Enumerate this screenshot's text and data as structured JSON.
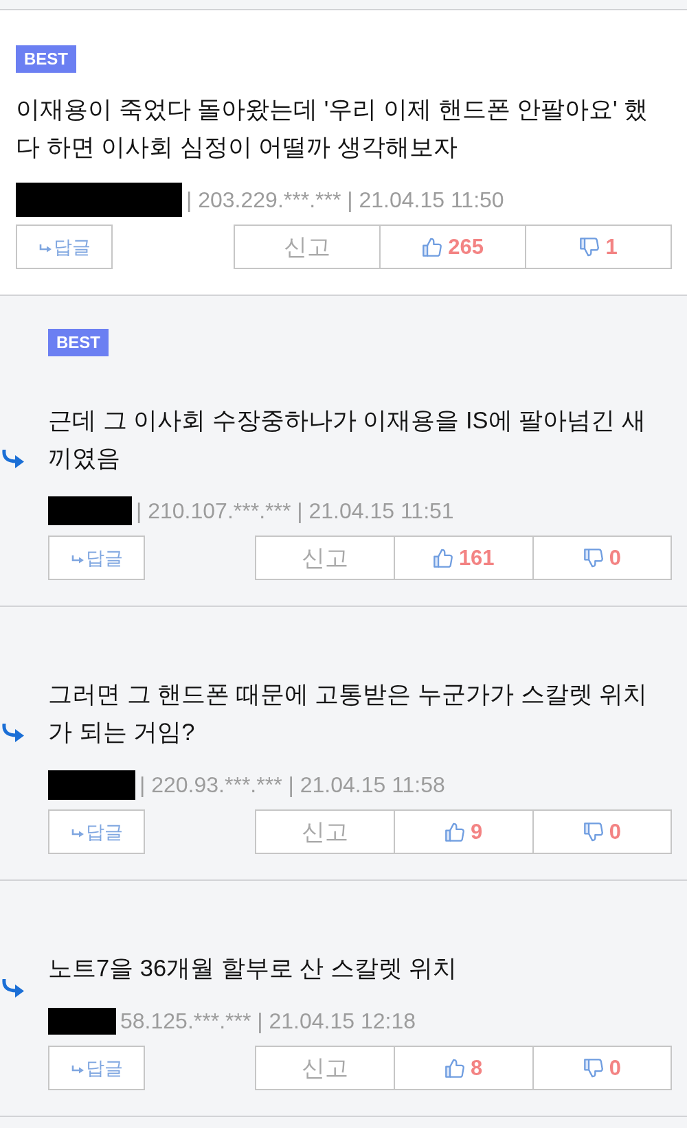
{
  "comments": [
    {
      "best": true,
      "best_label": "BEST",
      "reply": false,
      "text": "이재용이 죽었다 돌아왔는데 '우리 이제 핸드폰 안팔아요' 했다 하면 이사회 심정이 어떨까 생각해보자",
      "author_redacted": true,
      "meta": "| 203.229.***.*** | 21.04.15 11:50",
      "reply_label": "답글",
      "report_label": "신고",
      "likes": "265",
      "dislikes": "1"
    },
    {
      "best": true,
      "best_label": "BEST",
      "reply": true,
      "text": "근데 그 이사회 수장중하나가 이재용을 IS에 팔아넘긴 새끼였음",
      "author_redacted": true,
      "meta": "| 210.107.***.*** | 21.04.15 11:51",
      "reply_label": "답글",
      "report_label": "신고",
      "likes": "161",
      "dislikes": "0"
    },
    {
      "best": false,
      "reply": true,
      "text": "그러면 그 핸드폰 때문에 고통받은 누군가가 스칼렛 위치가 되는 거임?",
      "author_redacted": true,
      "meta": "| 220.93.***.*** | 21.04.15 11:58",
      "reply_label": "답글",
      "report_label": "신고",
      "likes": "9",
      "dislikes": "0"
    },
    {
      "best": false,
      "reply": true,
      "text": "노트7을 36개월 할부로 산 스칼렛 위치",
      "author_redacted": true,
      "meta": "58.125.***.*** | 21.04.15 12:18",
      "reply_label": "답글",
      "report_label": "신고",
      "likes": "8",
      "dislikes": "0"
    }
  ]
}
